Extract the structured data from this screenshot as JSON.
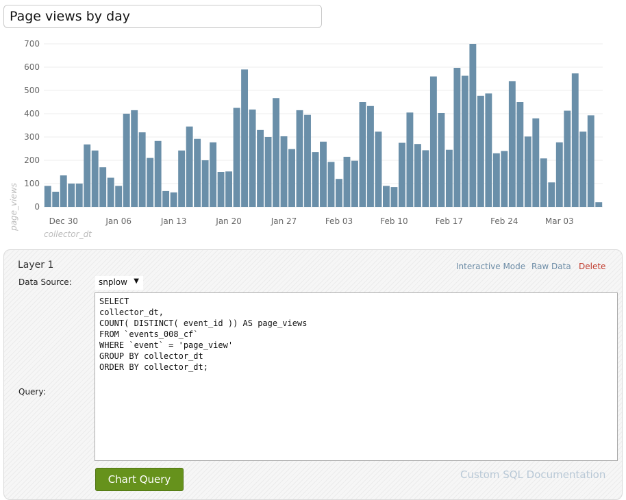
{
  "title": {
    "value": "Page views by day"
  },
  "chart_data": {
    "type": "bar",
    "xlabel": "collector_dt",
    "ylabel": "page_views",
    "ylim": [
      0,
      700
    ],
    "yticks": [
      "0",
      "100",
      "200",
      "300",
      "400",
      "500",
      "600",
      "700"
    ],
    "xticks": [
      "Dec 30",
      "Jan 06",
      "Jan 13",
      "Jan 20",
      "Jan 27",
      "Feb 03",
      "Feb 10",
      "Feb 17",
      "Feb 24",
      "Mar 03"
    ],
    "grid": true,
    "bar_color": "#6a8fa9",
    "series": [
      {
        "values": [
          90,
          65,
          135,
          100,
          100,
          268,
          242,
          170,
          125,
          90,
          400,
          415,
          320,
          210,
          283,
          68,
          62,
          242,
          345,
          292,
          200,
          277,
          150,
          152,
          425,
          590,
          418,
          330,
          300,
          467,
          303,
          248,
          415,
          395,
          235,
          280,
          193,
          120,
          215,
          198,
          450,
          433,
          323,
          90,
          85,
          275,
          405,
          270,
          243,
          560,
          403,
          245,
          597,
          563,
          700,
          477,
          487,
          230,
          240,
          540,
          450,
          302,
          380,
          208,
          105,
          277,
          413,
          573,
          323,
          393,
          20
        ]
      }
    ]
  },
  "layer": {
    "title": "Layer 1",
    "interactive_mode": "Interactive Mode",
    "raw_data": "Raw Data",
    "delete": "Delete",
    "data_source_label": "Data Source:",
    "data_source_value": "snplow",
    "query_label": "Query:",
    "query": "SELECT\ncollector_dt,\nCOUNT( DISTINCT( event_id )) AS page_views\nFROM `events_008_cf`\nWHERE `event` = 'page_view'\nGROUP BY collector_dt\nORDER BY collector_dt;",
    "chart_query_button": "Chart Query",
    "docs_link": "Custom SQL Documentation"
  },
  "colors": {
    "button": "#66921c",
    "link": "#6c8ca6",
    "delete": "#c0392b",
    "bars": "#6a8fa9"
  }
}
